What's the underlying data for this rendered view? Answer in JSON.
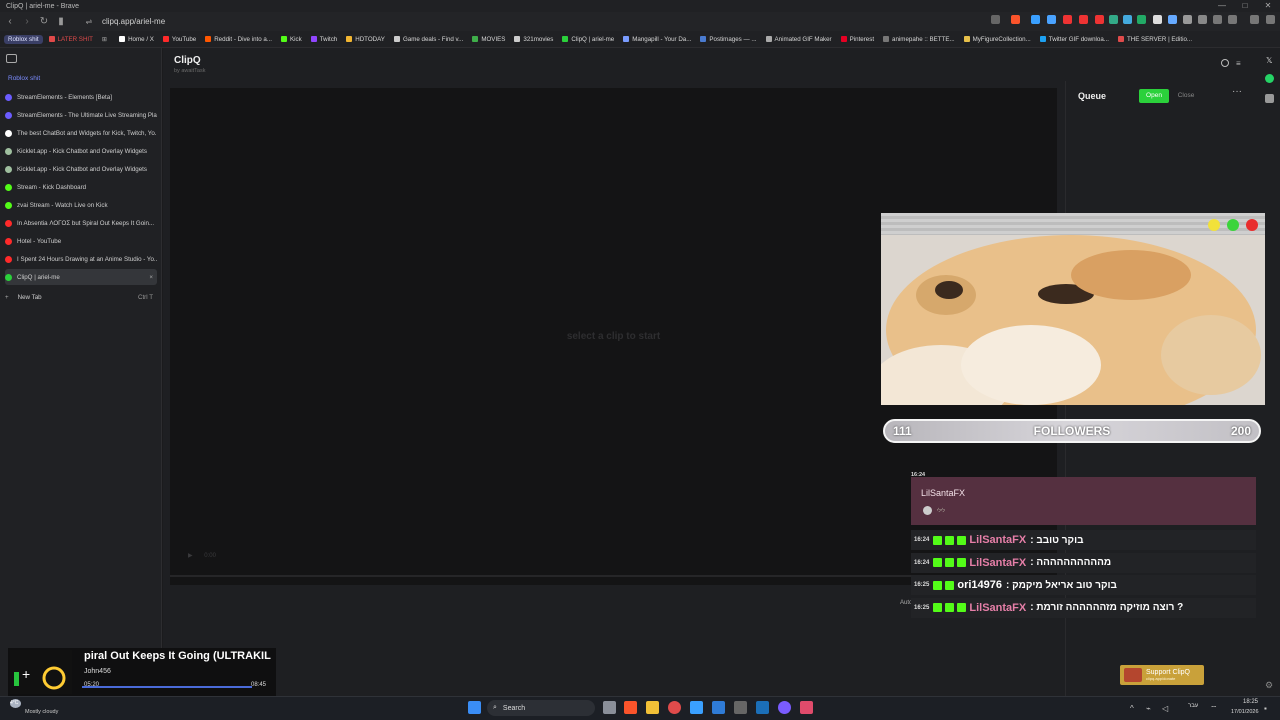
{
  "window": {
    "title": "ClipQ | ariel-me - Brave",
    "min": "—",
    "max": "□",
    "close": "✕"
  },
  "address": {
    "url": "clipq.app/ariel-me"
  },
  "bookmarks": [
    {
      "label": "Roblox shit",
      "color": "#3a3f66",
      "pill": true
    },
    {
      "label": "LATER SHIT",
      "color": "#e14a4a",
      "pill": false,
      "red": true
    },
    {
      "label": "Home / X",
      "color": "#ffffff"
    },
    {
      "label": "YouTube",
      "color": "#ff2a2a"
    },
    {
      "label": "Reddit - Dive into a...",
      "color": "#ff5700"
    },
    {
      "label": "Kick",
      "color": "#53fc18"
    },
    {
      "label": "Twitch",
      "color": "#9146ff"
    },
    {
      "label": "HDTODAY",
      "color": "#f2b632"
    },
    {
      "label": "Game deals - Find v...",
      "color": "#cccccc"
    },
    {
      "label": "MOVIES",
      "color": "#3fae4a"
    },
    {
      "label": "321movies",
      "color": "#cccccc"
    },
    {
      "label": "ClipQ | ariel-me",
      "color": "#2bd13b"
    },
    {
      "label": "Mangapill - Your Da...",
      "color": "#7a9cff"
    },
    {
      "label": "Postimages — ...",
      "color": "#4a7bd0"
    },
    {
      "label": "Animated GIF Maker",
      "color": "#aaaaaa"
    },
    {
      "label": "Pinterest",
      "color": "#e60023"
    },
    {
      "label": "animepahe :: BETTE...",
      "color": "#777777"
    },
    {
      "label": "MyFigureCollection...",
      "color": "#e7c04a"
    },
    {
      "label": "Twitter GIF downloa...",
      "color": "#1da1f2"
    },
    {
      "label": "THE SERVER | Editio...",
      "color": "#e04b4b"
    }
  ],
  "sidebar": {
    "folder": "Roblox shit",
    "items": [
      {
        "label": "StreamElements - Elements [Beta]",
        "color": "#6b5cff"
      },
      {
        "label": "StreamElements - The Ultimate Live Streaming Plat...",
        "color": "#6b5cff"
      },
      {
        "label": "The best ChatBot and Widgets for Kick, Twitch, Yo...",
        "color": "#ffffff"
      },
      {
        "label": "Kicklet.app - Kick Chatbot and Overlay Widgets",
        "color": "#9fbf9f"
      },
      {
        "label": "Kicklet.app - Kick Chatbot and Overlay Widgets",
        "color": "#9fbf9f"
      },
      {
        "label": "Stream - Kick Dashboard",
        "color": "#53fc18"
      },
      {
        "label": "zvai Stream - Watch Live on Kick",
        "color": "#53fc18"
      },
      {
        "label": "In Absentia ΛΟΓΟΣ but Spiral Out Keeps It Goin...",
        "color": "#ff2a2a"
      },
      {
        "label": "Hotel - YouTube",
        "color": "#ff2a2a"
      },
      {
        "label": "I Spent 24 Hours Drawing at an Anime Studio - Yo...",
        "color": "#ff2a2a"
      },
      {
        "label": "ClipQ | ariel-me",
        "color": "#2bd13b",
        "active": true
      }
    ],
    "new_tab": "New Tab",
    "new_tab_shortcut": "Ctrl T"
  },
  "app": {
    "title": "ClipQ",
    "by": "by awaitTask",
    "player_hint": "select a clip to start",
    "player_time": "0:00",
    "autoplay": "Autoplay"
  },
  "queue": {
    "title": "Queue",
    "open": "Open",
    "close": "Close",
    "more": "···"
  },
  "support": {
    "label": "Support ClipQ",
    "sub": "clipq.app/donate"
  },
  "followers": {
    "current": "111",
    "label": "FOLLOWERS",
    "goal": "200",
    "current_value": 111,
    "goal_value": 200
  },
  "chat": {
    "card": {
      "time": "16:24",
      "name": "LilSantaFX",
      "sub": "לילי"
    },
    "messages": [
      {
        "time": "16:24",
        "user": "LilSantaFX",
        "color": "#e67fa8",
        "text": ": בוקר טובב"
      },
      {
        "time": "16:24",
        "user": "LilSantaFX",
        "color": "#e67fa8",
        "text": ": מהההההההההה"
      },
      {
        "time": "16:25",
        "user": "ori14976",
        "color": "#ffffff",
        "text": ": בוקר טוב אריאל מיקמק"
      },
      {
        "time": "16:25",
        "user": "LilSantaFX",
        "color": "#e67fa8",
        "text": ": רוצה מוזיקה מזהההההה זורמת ?"
      }
    ]
  },
  "mini_player": {
    "title": "piral Out Keeps It Going (ULTRAKIL",
    "user": "John456",
    "time_start": "05:20",
    "time_end": "08:45"
  },
  "taskbar": {
    "weather": "Mostly cloudy",
    "temp": "4°C",
    "search": "Search",
    "time": "18:25",
    "date": "17/01/2026",
    "lang": "עבר"
  }
}
